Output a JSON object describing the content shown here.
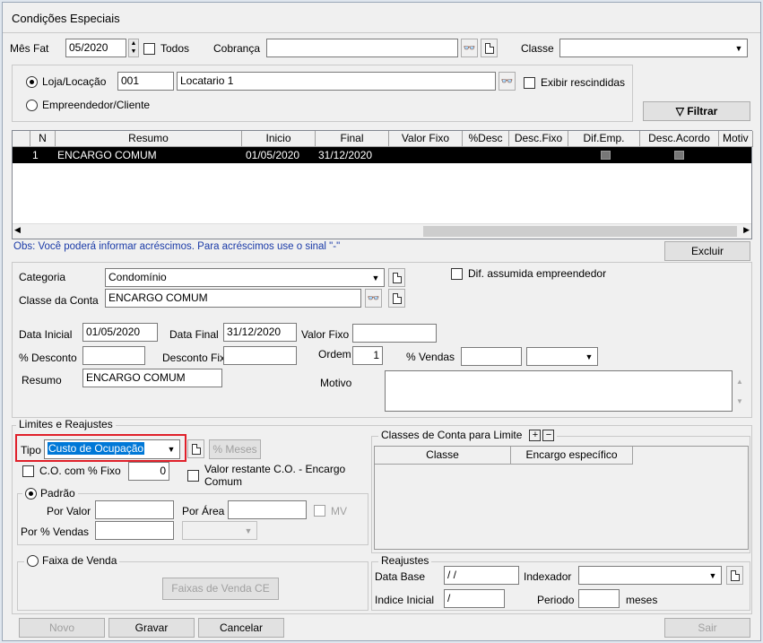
{
  "window": {
    "title": "Condições Especiais"
  },
  "filter": {
    "mes_fat_label": "Mês Fat",
    "mes_fat_value": "05/2020",
    "todos_label": "Todos",
    "cobranca_label": "Cobrança",
    "cobranca_value": "",
    "classe_label": "Classe",
    "classe_value": "",
    "loja_label": "Loja/Locação",
    "loja_code": "001",
    "loja_name": "Locatario 1",
    "exibir_label": "Exibir rescindidas",
    "empreendedor_label": "Empreendedor/Cliente",
    "filtrar_label": "Filtrar"
  },
  "grid": {
    "columns": [
      "N",
      "Resumo",
      "Inicio",
      "Final",
      "Valor Fixo",
      "%Desc",
      "Desc.Fixo",
      "Dif.Emp.",
      "Desc.Acordo",
      "Motiv"
    ],
    "rows": [
      {
        "n": "1",
        "resumo": "ENCARGO COMUM",
        "inicio": "01/05/2020",
        "final": "31/12/2020"
      }
    ]
  },
  "obs_text": "Obs: Você poderá informar acréscimos. Para acréscimos use o sinal \"-\"",
  "excluir_label": "Excluir",
  "detail": {
    "categoria_label": "Categoria",
    "categoria_value": "Condomínio",
    "dif_label": "Dif. assumida empreendedor",
    "classe_conta_label": "Classe da Conta",
    "classe_conta_value": "ENCARGO COMUM",
    "data_inicial_label": "Data Inicial",
    "data_inicial_value": "01/05/2020",
    "data_final_label": "Data Final",
    "data_final_value": "31/12/2020",
    "valor_fixo_label": "Valor Fixo",
    "desconto_label": "% Desconto",
    "desconto_fixo_label": "Desconto Fixo",
    "ordem_label": "Ordem",
    "ordem_value": "1",
    "vendas_label": "% Vendas",
    "resumo_label": "Resumo",
    "resumo_value": "ENCARGO COMUM",
    "motivo_label": "Motivo"
  },
  "limites": {
    "title": "Limites e Reajustes",
    "tipo_label": "Tipo",
    "tipo_value": "Custo de Ocupação",
    "meses_label": "% Meses",
    "co_fixo_label": "C.O. com % Fixo",
    "co_fixo_value": "0",
    "valor_restante_label": "Valor restante C.O. - Encargo Comum",
    "padrao_label": "Padrão",
    "por_valor_label": "Por Valor",
    "por_area_label": "Por Área",
    "mv_label": "MV",
    "por_vendas_label": "Por % Vendas",
    "faixa_label": "Faixa de Venda",
    "faixas_btn": "Faixas de Venda CE"
  },
  "classes_limite": {
    "title": "Classes de Conta para Limite",
    "plus": "+",
    "minus": "−",
    "col_classe": "Classe",
    "col_encargo": "Encargo específico"
  },
  "reajustes": {
    "title": "Reajustes",
    "data_base_label": "Data Base",
    "data_base_value": " /  /",
    "indexador_label": "Indexador",
    "indice_label": "Indice Inicial",
    "indice_value": " /",
    "periodo_label": "Periodo",
    "meses_label": "meses"
  },
  "footer": {
    "novo": "Novo",
    "gravar": "Gravar",
    "cancelar": "Cancelar",
    "sair": "Sair"
  }
}
